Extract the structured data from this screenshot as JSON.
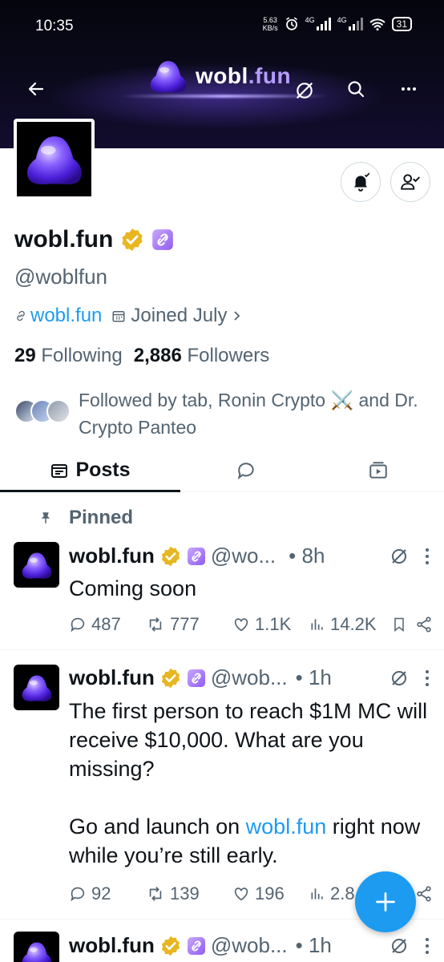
{
  "status_bar": {
    "time": "10:35",
    "speed_top": "5.63",
    "speed_bottom": "KB/s",
    "net1": "4G",
    "net2": "4G",
    "battery": "31"
  },
  "banner": {
    "brand_main": "wobl",
    "brand_dot_fun": ".fun"
  },
  "profile": {
    "name": "wobl.fun",
    "handle": "@woblfun",
    "link": "wobl.fun",
    "joined": "Joined July",
    "following_count": "29",
    "following_label": "Following",
    "followers_count": "2,886",
    "followers_label": "Followers",
    "followed_by": "Followed by tab, Ronin Crypto ⚔️ and Dr. Crypto Panteo"
  },
  "tabs": {
    "posts": "Posts"
  },
  "pinned_label": "Pinned",
  "tweets": [
    {
      "name": "wobl.fun",
      "handle": "@wo...",
      "time": "• 8h",
      "text": "Coming soon",
      "replies": "487",
      "reposts": "777",
      "likes": "1.1K",
      "views": "14.2K"
    },
    {
      "name": "wobl.fun",
      "handle": "@wob...",
      "time": "• 1h",
      "text1": "The first person to reach $1M MC will receive $10,000. What are you missing?",
      "text2_pre": "Go and launch on ",
      "text2_link": "wobl.fun",
      "text2_post": " right now while you’re still early.",
      "replies": "92",
      "reposts": "139",
      "likes": "196",
      "views": "2.8"
    },
    {
      "name": "wobl.fun",
      "handle": "@wob...",
      "time": "• 1h"
    }
  ],
  "colors": {
    "accent": "#1d9bf0",
    "muted": "#536471",
    "verified_gold": "#e8b620",
    "purple_badge": "#a474f5"
  }
}
